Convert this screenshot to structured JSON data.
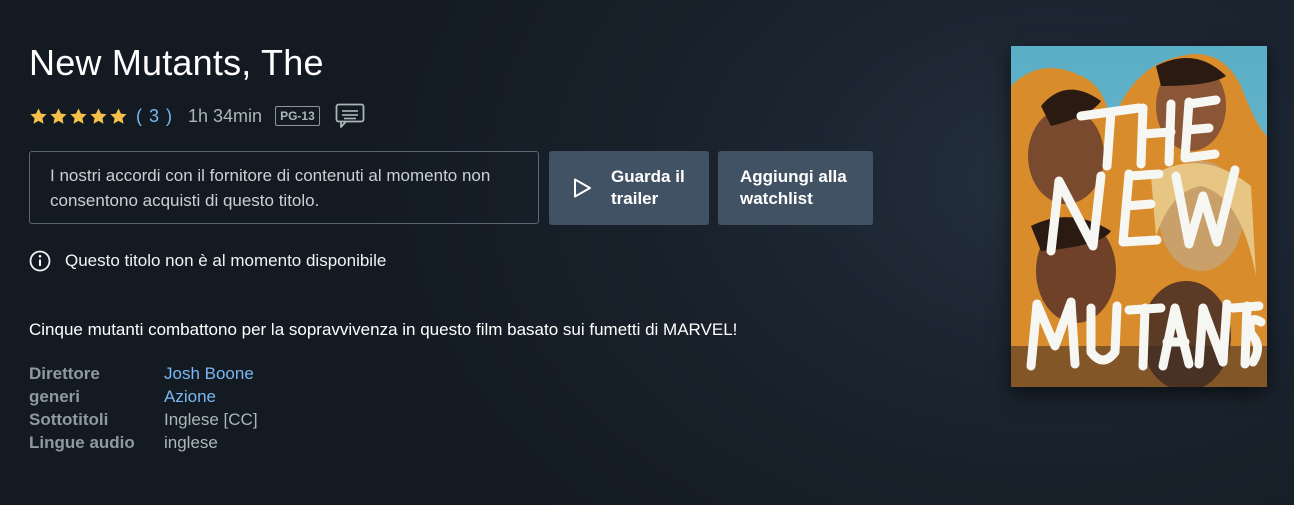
{
  "title": "New Mutants, The",
  "rating": {
    "stars": 5,
    "count": "( 3 )"
  },
  "runtime": "1h 34min",
  "maturity_rating": "PG-13",
  "icons": {
    "subtitles": "subtitles-icon",
    "play": "play-icon",
    "info": "info-icon",
    "star": "star-icon"
  },
  "colors": {
    "accent_link": "#79b8f3",
    "star": "#f5c04a",
    "button_bg": "#425265"
  },
  "notice": "I nostri accordi con il fornitore di contenuti al momento non consentono acquisti di questo titolo.",
  "buttons": {
    "trailer": "Guarda il trailer",
    "watchlist": "Aggiungi alla watchlist"
  },
  "availability": "Questo titolo non è al momento disponibile",
  "synopsis": "Cinque mutanti combattono per la sopravvivenza in questo film basato sui fumetti di MARVEL!",
  "details": [
    {
      "label": "Direttore",
      "value": "Josh Boone"
    },
    {
      "label": "generi",
      "value": "Azione"
    },
    {
      "label": "Sottotitoli",
      "value": "Inglese [CC]"
    },
    {
      "label": "Lingue audio",
      "value": "inglese"
    }
  ],
  "poster": {
    "title_art": [
      "THE",
      "NEW",
      "MUTANTS"
    ]
  }
}
